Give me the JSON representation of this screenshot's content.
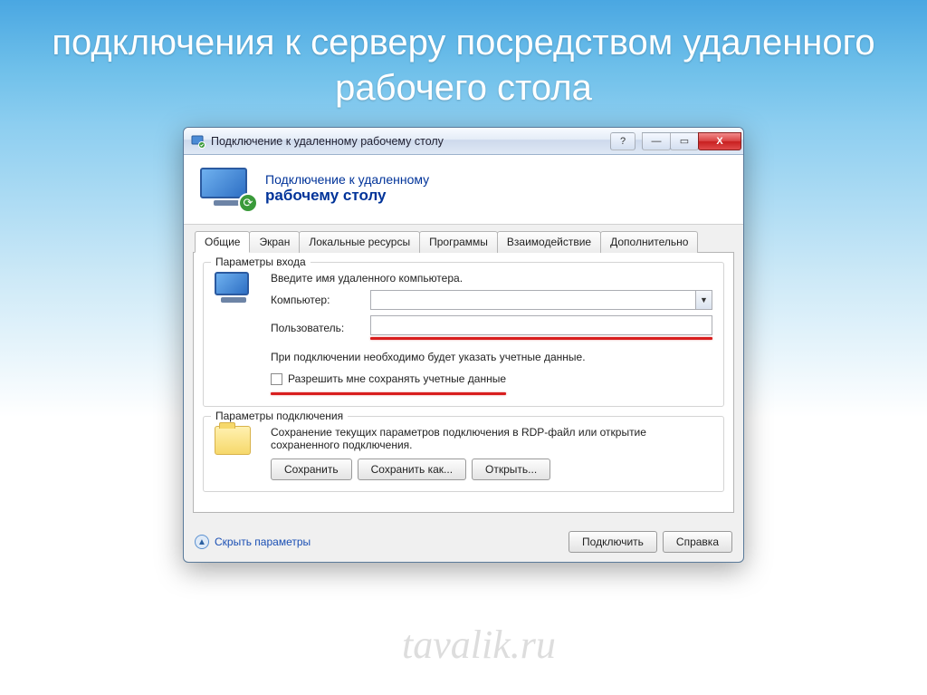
{
  "slide": {
    "title": "подключения к серверу посредством удаленного рабочего стола"
  },
  "window": {
    "title": "Подключение к удаленному рабочему столу",
    "help_glyph": "?",
    "min_glyph": "—",
    "max_glyph": "▭",
    "close_glyph": "X"
  },
  "header": {
    "line1": "Подключение к удаленному",
    "line2": "рабочему столу"
  },
  "tabs": [
    {
      "label": "Общие",
      "active": true
    },
    {
      "label": "Экран",
      "active": false
    },
    {
      "label": "Локальные ресурсы",
      "active": false
    },
    {
      "label": "Программы",
      "active": false
    },
    {
      "label": "Взаимодействие",
      "active": false
    },
    {
      "label": "Дополнительно",
      "active": false
    }
  ],
  "login_group": {
    "legend": "Параметры входа",
    "intro": "Введите имя удаленного компьютера.",
    "computer_label": "Компьютер:",
    "computer_value": "",
    "user_label": "Пользователь:",
    "user_value": "",
    "note": "При подключении необходимо будет указать учетные данные.",
    "save_creds_label": "Разрешить мне сохранять учетные данные"
  },
  "conn_group": {
    "legend": "Параметры подключения",
    "desc": "Сохранение текущих параметров подключения в RDP-файл или открытие сохраненного подключения.",
    "save_btn": "Сохранить",
    "saveas_btn": "Сохранить как...",
    "open_btn": "Открыть..."
  },
  "bottom": {
    "hide_params": "Скрыть параметры",
    "connect_btn": "Подключить",
    "help_btn": "Справка"
  },
  "watermark": "tavalik.ru"
}
